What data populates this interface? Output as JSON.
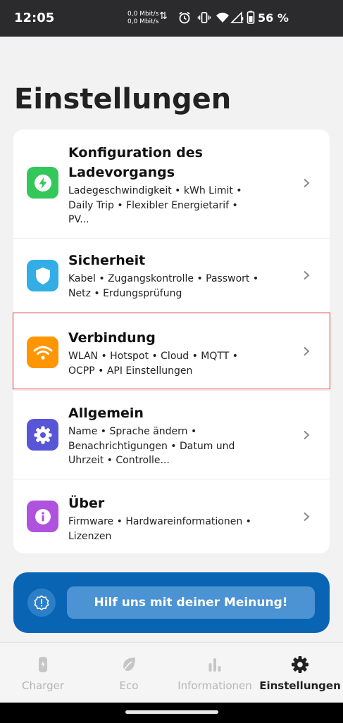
{
  "status_bar": {
    "time": "12:05",
    "net_up": "0,0 Mbit/s",
    "net_down": "0,0 Mbit/s",
    "battery": "56 %"
  },
  "page_title": "Einstellungen",
  "settings": [
    {
      "title": "Konfiguration des Ladevorgangs",
      "subtitle": "Ladegeschwindigkeit • kWh Limit • Daily Trip • Flexibler Energietarif • PV...",
      "icon": "bolt-icon",
      "color": "#34c759"
    },
    {
      "title": "Sicherheit",
      "subtitle": "Kabel • Zugangskontrolle • Passwort • Netz • Erdungsprüfung",
      "icon": "shield-icon",
      "color": "#32ade6"
    },
    {
      "title": "Verbindung",
      "subtitle": "WLAN • Hotspot • Cloud • MQTT • OCPP • API Einstellungen",
      "icon": "wifi-icon",
      "color": "#ff9500"
    },
    {
      "title": "Allgemein",
      "subtitle": "Name • Sprache ändern • Benachrichtigungen • Datum und Uhrzeit • Controlle...",
      "icon": "gear-icon",
      "color": "#5856d6"
    },
    {
      "title": "Über",
      "subtitle": "Firmware • Hardwareinformationen • Lizenzen",
      "icon": "info-icon",
      "color": "#af52de"
    }
  ],
  "feedback": {
    "label": "Hilf uns mit deiner Meinung!",
    "color": "#0a64b4"
  },
  "bottom_nav": [
    {
      "label": "Charger",
      "icon": "charger-icon",
      "active": false
    },
    {
      "label": "Eco",
      "icon": "leaf-icon",
      "active": false
    },
    {
      "label": "Informationen",
      "icon": "bar-chart-icon",
      "active": false
    },
    {
      "label": "Einstellungen",
      "icon": "gear-icon",
      "active": true
    }
  ]
}
